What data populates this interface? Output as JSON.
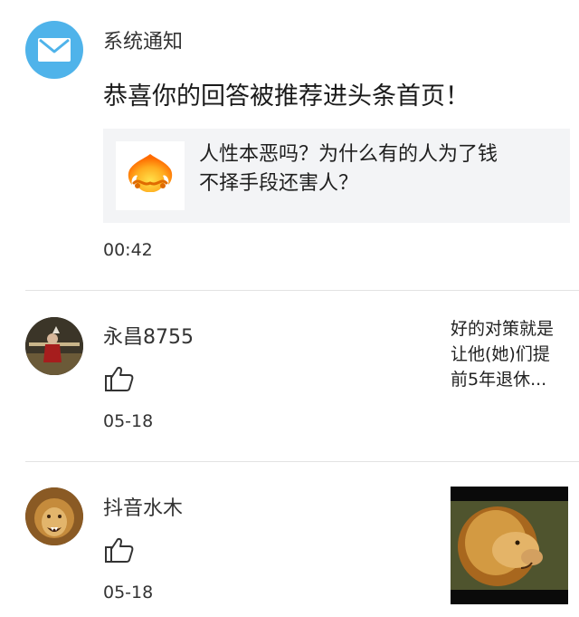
{
  "notification": {
    "sender": "系统通知",
    "message": "恭喜你的回答被推荐进头条首页！",
    "quote_line1": "人性本恶吗？为什么有的人为了钱",
    "quote_line2": "不择手段还害人？",
    "time": "00:42",
    "avatar_icon": "mail-icon",
    "avatar_color": "#4fb3ea",
    "thumb_icon": "golden-headband-icon"
  },
  "comments": [
    {
      "name": "永昌8755",
      "time": "05-18",
      "preview_line1": "好的对策就是",
      "preview_line2": "让他(她)们提",
      "preview_line3": "前5年退休...",
      "like_icon": "thumbs-up-icon"
    },
    {
      "name": "抖音水木",
      "time": "05-18",
      "like_icon": "thumbs-up-icon",
      "thumb_icon": "lion-image"
    }
  ]
}
